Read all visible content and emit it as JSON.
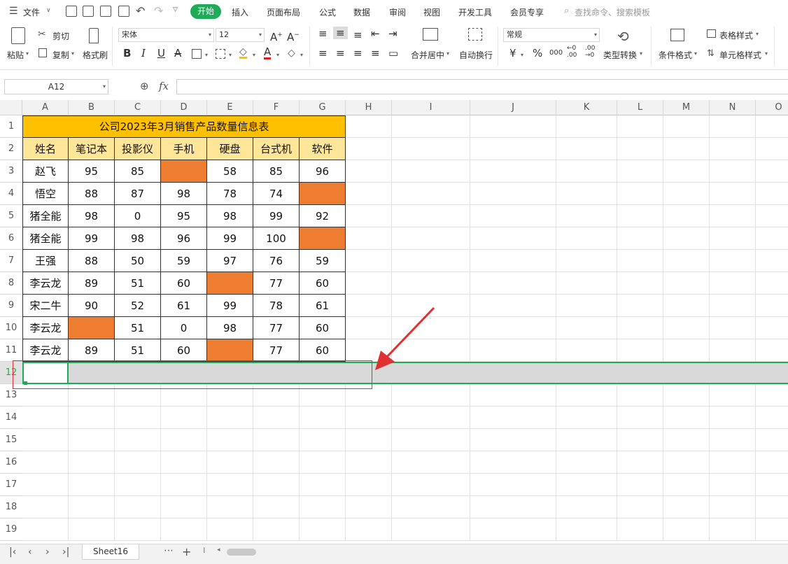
{
  "menu": {
    "file_label": "文件",
    "tabs": [
      "开始",
      "插入",
      "页面布局",
      "公式",
      "数据",
      "审阅",
      "视图",
      "开发工具",
      "会员专享"
    ],
    "search_placeholder": "查找命令、搜索模板"
  },
  "ribbon": {
    "paste": "粘贴",
    "cut": "剪切",
    "copy": "复制",
    "format_painter": "格式刷",
    "font_name": "宋体",
    "font_size": "12",
    "bold": "B",
    "italic": "I",
    "underline": "U",
    "merge_center": "合并居中",
    "wrap_text": "自动换行",
    "number_format": "常规",
    "currency": "¥",
    "percent": "%",
    "thousands": "000",
    "inc_decimal": "←0 .00",
    "dec_decimal": ".00 →0",
    "type_convert": "类型转换",
    "conditional_format": "条件格式",
    "table_style": "表格样式",
    "cell_style": "单元格样式"
  },
  "formula_bar": {
    "name_box": "A12",
    "fx": "fx"
  },
  "columns": [
    "A",
    "B",
    "C",
    "D",
    "E",
    "F",
    "G",
    "H",
    "I",
    "J",
    "K",
    "L",
    "M",
    "N",
    "O"
  ],
  "rows": [
    "1",
    "2",
    "3",
    "4",
    "5",
    "6",
    "7",
    "8",
    "9",
    "10",
    "11",
    "12",
    "13",
    "14",
    "15",
    "16",
    "17",
    "18",
    "19"
  ],
  "table": {
    "title": "公司2023年3月销售产品数量信息表",
    "headers": [
      "姓名",
      "笔记本",
      "投影仪",
      "手机",
      "硬盘",
      "台式机",
      "软件"
    ],
    "data": [
      [
        "赵飞",
        "95",
        "85",
        "",
        "58",
        "85",
        "96"
      ],
      [
        "悟空",
        "88",
        "87",
        "98",
        "78",
        "74",
        ""
      ],
      [
        "猪全能",
        "98",
        "0",
        "95",
        "98",
        "99",
        "92"
      ],
      [
        "猪全能",
        "99",
        "98",
        "96",
        "99",
        "100",
        ""
      ],
      [
        "王强",
        "88",
        "50",
        "59",
        "97",
        "76",
        "59"
      ],
      [
        "李云龙",
        "89",
        "51",
        "60",
        "",
        "77",
        "60"
      ],
      [
        "宋二牛",
        "90",
        "52",
        "61",
        "99",
        "78",
        "61"
      ],
      [
        "李云龙",
        "",
        "51",
        "0",
        "98",
        "77",
        "60"
      ],
      [
        "李云龙",
        "89",
        "51",
        "60",
        "",
        "77",
        "60"
      ]
    ],
    "highlight_cells": [
      [
        0,
        3
      ],
      [
        1,
        6
      ],
      [
        3,
        6
      ],
      [
        5,
        4
      ],
      [
        7,
        1
      ],
      [
        8,
        4
      ]
    ]
  },
  "colors": {
    "accent": "#1faa5a",
    "title_fill": "#ffc000",
    "header_fill": "#ffe699",
    "highlight": "#ed7d31",
    "annotation": "#e03030"
  },
  "sheet_tab": "Sheet16"
}
